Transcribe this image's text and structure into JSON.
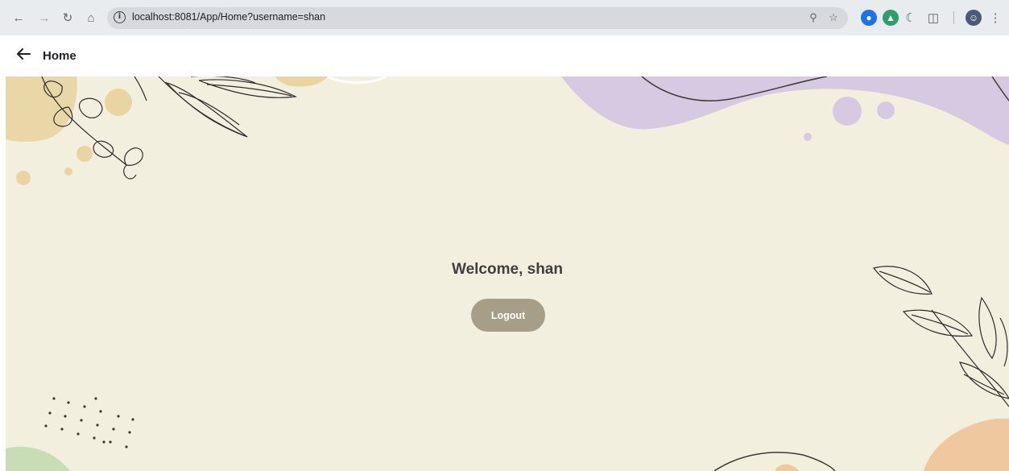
{
  "browser": {
    "url": "localhost:8081/App/Home?username=shan",
    "icons": [
      "back-icon",
      "forward-icon",
      "reload-icon",
      "home-icon",
      "site-info-icon",
      "password-key-icon",
      "bookmark-star-icon",
      "extension-icons",
      "puzzle-icon",
      "profile-avatar",
      "kebab-menu-icon"
    ]
  },
  "header": {
    "title": "Home"
  },
  "main": {
    "welcome_text": "Welcome, shan",
    "logout_label": "Logout"
  },
  "colors": {
    "background": "#f3efdf",
    "button": "#a79e89",
    "lilac": "#d8c9e3",
    "gold": "#e9d4a2",
    "peach": "#f0c8a0",
    "sage": "#c8ddb6"
  }
}
